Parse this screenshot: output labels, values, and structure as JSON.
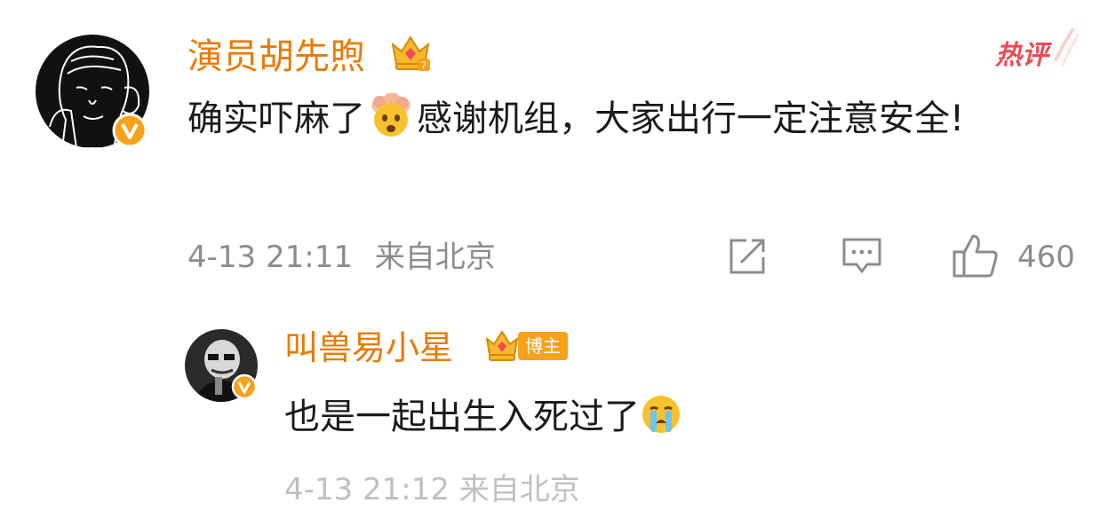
{
  "main_comment": {
    "author": "演员胡先煦",
    "badge": "热评",
    "text_before": "确实吓麻了",
    "emoji_1": "exploding-head",
    "text_after": "感谢机组，大家出行一定注意安全!",
    "time": "4-13 21:11",
    "location": "来自北京",
    "likes": "460"
  },
  "reply": {
    "author": "叫兽易小星",
    "tag": "博主",
    "text": "也是一起出生入死过了",
    "emoji": "loudly-crying-face",
    "meta_partial": "4-13 21:12  来自北京"
  },
  "colors": {
    "author_name": "#e97a00",
    "hot_badge": "#f04a55",
    "verified_badge": "#f6a21a",
    "meta_text": "#8c8c8c"
  }
}
